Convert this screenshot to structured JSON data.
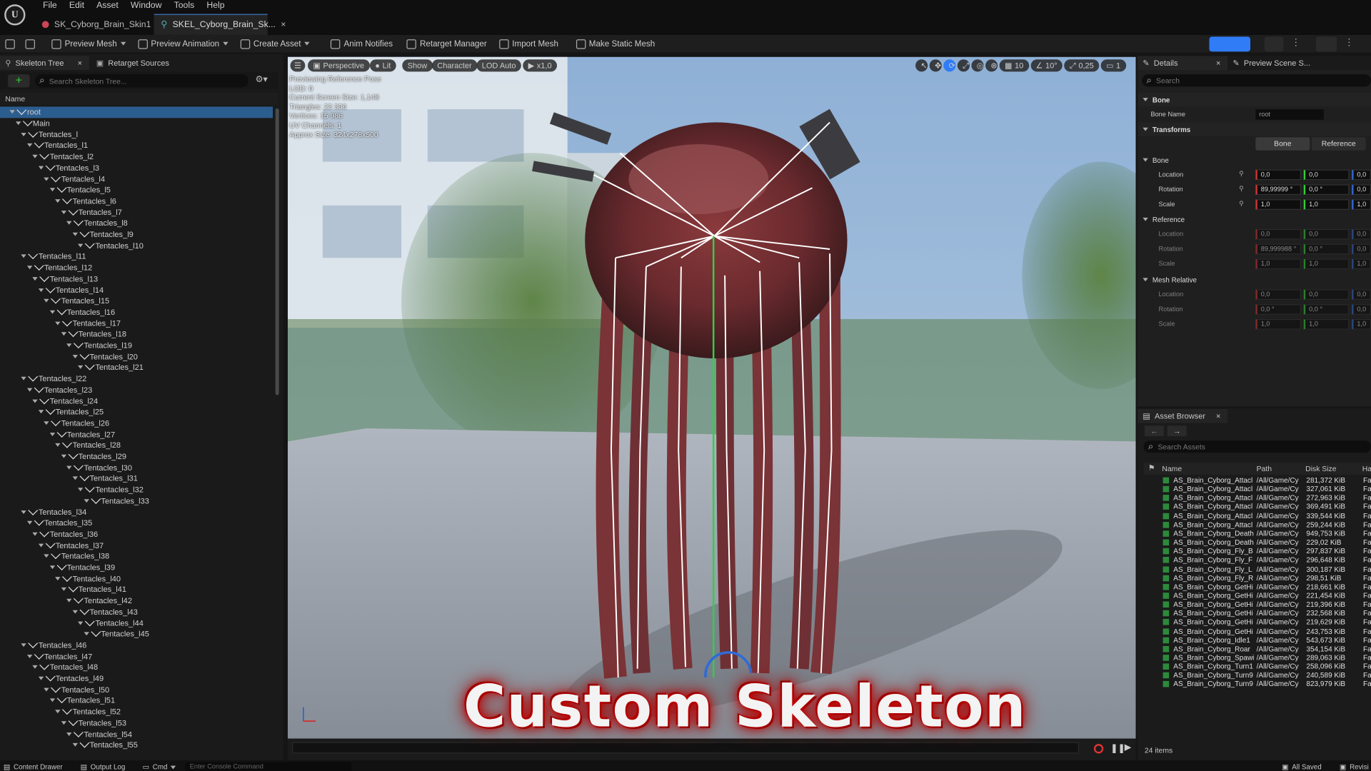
{
  "menu": [
    "File",
    "Edit",
    "Asset",
    "Window",
    "Tools",
    "Help"
  ],
  "tabs": [
    {
      "label": "SK_Cyborg_Brain_Skin1",
      "active": false
    },
    {
      "label": "SKEL_Cyborg_Brain_Sk...",
      "active": true
    }
  ],
  "toolbar": {
    "preview_mesh": "Preview Mesh",
    "preview_animation": "Preview Animation",
    "create_asset": "Create Asset",
    "anim_notifies": "Anim Notifies",
    "retarget_manager": "Retarget Manager",
    "import_mesh": "Import Mesh",
    "make_static_mesh": "Make Static Mesh"
  },
  "skeleton_panel": {
    "tab1": "Skeleton Tree",
    "tab2": "Retarget Sources",
    "search_placeholder": "Search Skeleton Tree...",
    "column": "Name",
    "items": [
      {
        "label": "root",
        "depth": 0,
        "selected": true
      },
      {
        "label": "Main",
        "depth": 1
      },
      {
        "label": "Tentacles_l",
        "depth": 2
      },
      {
        "label": "Tentacles_l1",
        "depth": 3
      },
      {
        "label": "Tentacles_l2",
        "depth": 4
      },
      {
        "label": "Tentacles_l3",
        "depth": 5
      },
      {
        "label": "Tentacles_l4",
        "depth": 6
      },
      {
        "label": "Tentacles_l5",
        "depth": 7
      },
      {
        "label": "Tentacles_l6",
        "depth": 8
      },
      {
        "label": "Tentacles_l7",
        "depth": 9
      },
      {
        "label": "Tentacles_l8",
        "depth": 10
      },
      {
        "label": "Tentacles_l9",
        "depth": 11
      },
      {
        "label": "Tentacles_l10",
        "depth": 12
      },
      {
        "label": "Tentacles_l11",
        "depth": 2
      },
      {
        "label": "Tentacles_l12",
        "depth": 3
      },
      {
        "label": "Tentacles_l13",
        "depth": 4
      },
      {
        "label": "Tentacles_l14",
        "depth": 5
      },
      {
        "label": "Tentacles_l15",
        "depth": 6
      },
      {
        "label": "Tentacles_l16",
        "depth": 7
      },
      {
        "label": "Tentacles_l17",
        "depth": 8
      },
      {
        "label": "Tentacles_l18",
        "depth": 9
      },
      {
        "label": "Tentacles_l19",
        "depth": 10
      },
      {
        "label": "Tentacles_l20",
        "depth": 11
      },
      {
        "label": "Tentacles_l21",
        "depth": 12
      },
      {
        "label": "Tentacles_l22",
        "depth": 2
      },
      {
        "label": "Tentacles_l23",
        "depth": 3
      },
      {
        "label": "Tentacles_l24",
        "depth": 4
      },
      {
        "label": "Tentacles_l25",
        "depth": 5
      },
      {
        "label": "Tentacles_l26",
        "depth": 6
      },
      {
        "label": "Tentacles_l27",
        "depth": 7
      },
      {
        "label": "Tentacles_l28",
        "depth": 8
      },
      {
        "label": "Tentacles_l29",
        "depth": 9
      },
      {
        "label": "Tentacles_l30",
        "depth": 10
      },
      {
        "label": "Tentacles_l31",
        "depth": 11
      },
      {
        "label": "Tentacles_l32",
        "depth": 12
      },
      {
        "label": "Tentacles_l33",
        "depth": 13
      },
      {
        "label": "Tentacles_l34",
        "depth": 2
      },
      {
        "label": "Tentacles_l35",
        "depth": 3
      },
      {
        "label": "Tentacles_l36",
        "depth": 4
      },
      {
        "label": "Tentacles_l37",
        "depth": 5
      },
      {
        "label": "Tentacles_l38",
        "depth": 6
      },
      {
        "label": "Tentacles_l39",
        "depth": 7
      },
      {
        "label": "Tentacles_l40",
        "depth": 8
      },
      {
        "label": "Tentacles_l41",
        "depth": 9
      },
      {
        "label": "Tentacles_l42",
        "depth": 10
      },
      {
        "label": "Tentacles_l43",
        "depth": 11
      },
      {
        "label": "Tentacles_l44",
        "depth": 12
      },
      {
        "label": "Tentacles_l45",
        "depth": 13
      },
      {
        "label": "Tentacles_l46",
        "depth": 2
      },
      {
        "label": "Tentacles_l47",
        "depth": 3
      },
      {
        "label": "Tentacles_l48",
        "depth": 4
      },
      {
        "label": "Tentacles_l49",
        "depth": 5
      },
      {
        "label": "Tentacles_l50",
        "depth": 6
      },
      {
        "label": "Tentacles_l51",
        "depth": 7
      },
      {
        "label": "Tentacles_l52",
        "depth": 8
      },
      {
        "label": "Tentacles_l53",
        "depth": 9
      },
      {
        "label": "Tentacles_l54",
        "depth": 10
      },
      {
        "label": "Tentacles_l55",
        "depth": 11
      }
    ]
  },
  "viewport": {
    "perspective": "Perspective",
    "lit": "Lit",
    "show": "Show",
    "character": "Character",
    "lod": "LOD Auto",
    "speed": "x1,0",
    "grid": "10",
    "angle": "10°",
    "scale": "0,25",
    "camera": "1",
    "stats": [
      "Previewing Reference Pose",
      "LOD: 0",
      "Current Screen Size: 1,148",
      "Triangles: 23 306",
      "Vertices: 15 986",
      "UV Channels: 1",
      "Approx Size: 324x278x500"
    ],
    "overlay_title": "Custom Skeleton"
  },
  "details": {
    "tab1": "Details",
    "tab2": "Preview Scene S...",
    "search_placeholder": "Search",
    "sec_bone": "Bone",
    "bone_name_label": "Bone Name",
    "bone_name_value": "root",
    "sec_transforms": "Transforms",
    "btn_bone": "Bone",
    "btn_reference": "Reference",
    "sub_bone": "Bone",
    "sub_reference": "Reference",
    "sub_mesh_relative": "Mesh Relative",
    "location": "Location",
    "rotation": "Rotation",
    "scale": "Scale",
    "bone_loc": [
      "0,0",
      "0,0",
      "0,0"
    ],
    "bone_rot": [
      "89,99999 °",
      "0,0 °",
      "0,0 °"
    ],
    "bone_scale": [
      "1,0",
      "1,0",
      "1,0"
    ],
    "ref_loc": [
      "0,0",
      "0,0",
      "0,0"
    ],
    "ref_rot": [
      "89,999988 °",
      "0,0 °",
      "0,0 °"
    ],
    "ref_scale": [
      "1,0",
      "1,0",
      "1,0"
    ],
    "mesh_loc": [
      "0,0",
      "0,0",
      "0,0"
    ],
    "mesh_rot": [
      "0,0 °",
      "0,0 °",
      "0,0 °"
    ],
    "mesh_scale": [
      "1,0",
      "1,0",
      "1,0"
    ]
  },
  "asset_browser": {
    "title": "Asset Browser",
    "search_placeholder": "Search Assets",
    "col_name": "Name",
    "col_path": "Path",
    "col_size": "Disk Size",
    "col_extra": "Ha",
    "count": "24 items",
    "rows": [
      {
        "name": "AS_Brain_Cyborg_Attacl",
        "path": "/All/Game/Cy",
        "size": "281,372 KiB",
        "extra": "Fa"
      },
      {
        "name": "AS_Brain_Cyborg_Attacl",
        "path": "/All/Game/Cy",
        "size": "327,061 KiB",
        "extra": "Fa"
      },
      {
        "name": "AS_Brain_Cyborg_Attacl",
        "path": "/All/Game/Cy",
        "size": "272,963 KiB",
        "extra": "Fa"
      },
      {
        "name": "AS_Brain_Cyborg_Attacl",
        "path": "/All/Game/Cy",
        "size": "369,491 KiB",
        "extra": "Fa"
      },
      {
        "name": "AS_Brain_Cyborg_Attacl",
        "path": "/All/Game/Cy",
        "size": "339,544 KiB",
        "extra": "Fa"
      },
      {
        "name": "AS_Brain_Cyborg_Attacl",
        "path": "/All/Game/Cy",
        "size": "259,244 KiB",
        "extra": "Fa"
      },
      {
        "name": "AS_Brain_Cyborg_Death",
        "path": "/All/Game/Cy",
        "size": "949,753 KiB",
        "extra": "Fa"
      },
      {
        "name": "AS_Brain_Cyborg_Death",
        "path": "/All/Game/Cy",
        "size": "229,02 KiB",
        "extra": "Fa"
      },
      {
        "name": "AS_Brain_Cyborg_Fly_B",
        "path": "/All/Game/Cy",
        "size": "297,837 KiB",
        "extra": "Fa"
      },
      {
        "name": "AS_Brain_Cyborg_Fly_F",
        "path": "/All/Game/Cy",
        "size": "296,648 KiB",
        "extra": "Fa"
      },
      {
        "name": "AS_Brain_Cyborg_Fly_L",
        "path": "/All/Game/Cy",
        "size": "300,187 KiB",
        "extra": "Fa"
      },
      {
        "name": "AS_Brain_Cyborg_Fly_R",
        "path": "/All/Game/Cy",
        "size": "298,51 KiB",
        "extra": "Fa"
      },
      {
        "name": "AS_Brain_Cyborg_GetHi",
        "path": "/All/Game/Cy",
        "size": "218,661 KiB",
        "extra": "Fa"
      },
      {
        "name": "AS_Brain_Cyborg_GetHi",
        "path": "/All/Game/Cy",
        "size": "221,454 KiB",
        "extra": "Fa"
      },
      {
        "name": "AS_Brain_Cyborg_GetHi",
        "path": "/All/Game/Cy",
        "size": "219,396 KiB",
        "extra": "Fa"
      },
      {
        "name": "AS_Brain_Cyborg_GetHi",
        "path": "/All/Game/Cy",
        "size": "232,568 KiB",
        "extra": "Fa"
      },
      {
        "name": "AS_Brain_Cyborg_GetHi",
        "path": "/All/Game/Cy",
        "size": "219,629 KiB",
        "extra": "Fa"
      },
      {
        "name": "AS_Brain_Cyborg_GetHi",
        "path": "/All/Game/Cy",
        "size": "243,753 KiB",
        "extra": "Fa"
      },
      {
        "name": "AS_Brain_Cyborg_Idle1",
        "path": "/All/Game/Cy",
        "size": "543,673 KiB",
        "extra": "Fa"
      },
      {
        "name": "AS_Brain_Cyborg_Roar",
        "path": "/All/Game/Cy",
        "size": "354,154 KiB",
        "extra": "Fa"
      },
      {
        "name": "AS_Brain_Cyborg_Spawi",
        "path": "/All/Game/Cy",
        "size": "289,063 KiB",
        "extra": "Fa"
      },
      {
        "name": "AS_Brain_Cyborg_Turn1",
        "path": "/All/Game/Cy",
        "size": "258,096 KiB",
        "extra": "Fa"
      },
      {
        "name": "AS_Brain_Cyborg_Turn9",
        "path": "/All/Game/Cy",
        "size": "240,589 KiB",
        "extra": "Fa"
      },
      {
        "name": "AS_Brain_Cyborg_Turn9",
        "path": "/All/Game/Cy",
        "size": "823,979 KiB",
        "extra": "Fa"
      }
    ]
  },
  "bottom_bar": {
    "content_drawer": "Content Drawer",
    "output_log": "Output Log",
    "cmd": "Cmd",
    "console_placeholder": "Enter Console Command",
    "all_saved": "All Saved",
    "revision": "Revisi"
  },
  "colors": {
    "accent": "#2f7cf6",
    "selection": "#2c5d8f",
    "bone_line": "#ffffff",
    "green_axis": "#2fd04a",
    "red_axis": "#e23636"
  }
}
